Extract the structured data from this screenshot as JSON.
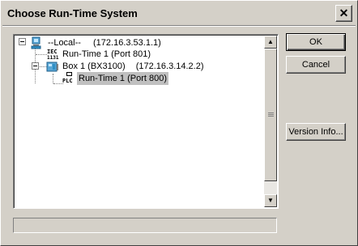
{
  "window": {
    "title": "Choose Run-Time System"
  },
  "tree": {
    "nodes": [
      {
        "label": "--Local--",
        "address": "(172.16.3.53.1.1)"
      },
      {
        "label": "Run-Time 1 (Port 801)"
      },
      {
        "label": "Box 1 (BX3100)",
        "address": "(172.16.3.14.2.2)"
      },
      {
        "label": "Run-Time 1 (Port 800)",
        "selected": true
      }
    ],
    "icons": {
      "iec_badge": "IEC\n1131",
      "plc_badge": "PLC"
    }
  },
  "buttons": {
    "ok": "OK",
    "cancel": "Cancel",
    "version_info": "Version Info..."
  },
  "status": {
    "text": ""
  }
}
